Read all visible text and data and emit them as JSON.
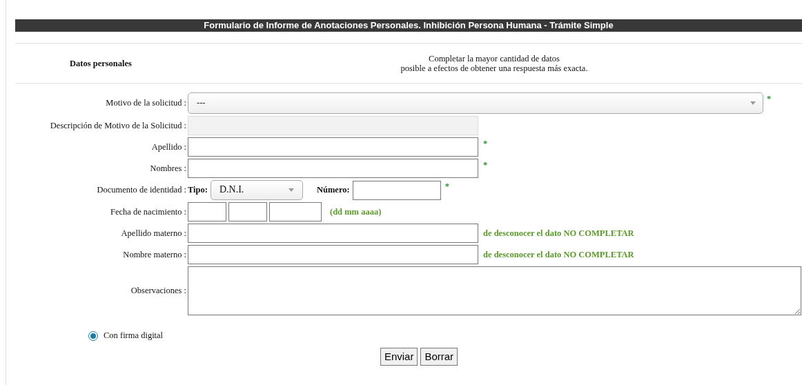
{
  "title": "Formulario de Informe de Anotaciones Personales. Inhibición Persona Humana - Trámite Simple",
  "section": {
    "label": "Datos personales",
    "note": [
      "Completar la mayor cantidad de datos",
      "posible a efectos de obtener una respuesta más exacta."
    ]
  },
  "fields": [
    {
      "kind": "select",
      "label": "Motivo de la solicitud :",
      "value": "---",
      "required_mark": "*"
    },
    {
      "kind": "text",
      "label": "Descripción de Motivo de la Solicitud :",
      "disabled": true
    },
    {
      "kind": "text",
      "label": "Apellido :",
      "disabled": false,
      "required_mark": "*"
    },
    {
      "kind": "text",
      "label": "Nombres :",
      "disabled": false,
      "required_mark": "*"
    },
    {
      "kind": "document",
      "label": "Documento de identidad :",
      "type_label": "Tipo:",
      "type_value": "D.N.I.",
      "number_label": "Número:",
      "required_mark": "*"
    },
    {
      "kind": "date",
      "label": "Fecha de nacimiento :",
      "hint": "(dd mm aaaa)"
    },
    {
      "kind": "text",
      "label": "Apellido materno :",
      "disabled": false,
      "hint": "de desconocer el dato NO COMPLETAR"
    },
    {
      "kind": "text",
      "label": "Nombre materno :",
      "disabled": false,
      "hint": "de desconocer el dato NO COMPLETAR"
    },
    {
      "kind": "textarea",
      "label": "Observaciones :"
    }
  ],
  "signature": {
    "label": "Con firma digital",
    "selected": true
  },
  "buttons": [
    "Enviar",
    "Borrar"
  ]
}
